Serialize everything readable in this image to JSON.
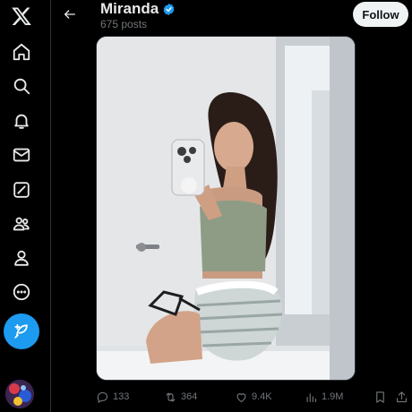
{
  "profile": {
    "name": "Miranda",
    "post_count": "675 posts",
    "follow_label": "Follow"
  },
  "sidebar": {
    "items": [
      {
        "name": "home"
      },
      {
        "name": "explore"
      },
      {
        "name": "notifications"
      },
      {
        "name": "messages"
      },
      {
        "name": "grok"
      },
      {
        "name": "communities"
      },
      {
        "name": "profile"
      },
      {
        "name": "more"
      }
    ]
  },
  "actions": {
    "replies": "133",
    "reposts": "364",
    "likes": "9.4K",
    "views": "1.9M"
  },
  "colors": {
    "accent": "#1d9bf0",
    "background": "#000000",
    "text": "#e7e9ea",
    "muted": "#71767b"
  }
}
